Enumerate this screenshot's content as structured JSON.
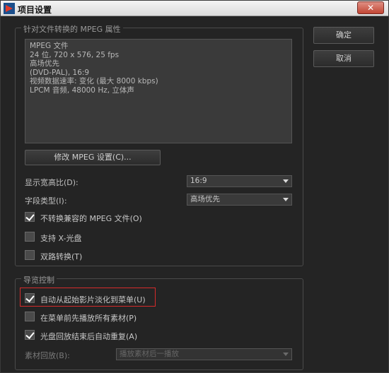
{
  "window": {
    "title": "项目设置",
    "close_label": "✕"
  },
  "buttons": {
    "ok": "确定",
    "cancel": "取消"
  },
  "mpeg_group": {
    "label": "针对文件转换的 MPEG 属性",
    "info_lines": [
      "MPEG 文件",
      "24 位, 720 x 576, 25 fps",
      "高场优先",
      "(DVD-PAL), 16:9",
      "视频数据速率: 变化 (最大 8000 kbps)",
      "LPCM 音频, 48000 Hz, 立体声"
    ],
    "modify_button": "修改 MPEG 设置(C)...",
    "aspect_label": "显示宽高比(D):",
    "aspect_value": "16:9",
    "field_label": "字段类型(I):",
    "field_value": "高场优先",
    "checks": [
      {
        "label": "不转换兼容的 MPEG 文件(O)",
        "checked": true
      },
      {
        "label": "支持 X-光盘",
        "checked": false
      },
      {
        "label": "双路转换(T)",
        "checked": false
      }
    ]
  },
  "nav_group": {
    "label": "导览控制",
    "checks": [
      {
        "label": "自动从起始影片淡化到菜单(U)",
        "checked": true
      },
      {
        "label": "在菜单前先播放所有素材(P)",
        "checked": false
      },
      {
        "label": "光盘回放结束后自动重复(A)",
        "checked": true
      }
    ],
    "playback_label": "素材回放(B):",
    "playback_value": "播放素材后一播放"
  },
  "colors": {
    "highlight": "#d62b2b"
  }
}
